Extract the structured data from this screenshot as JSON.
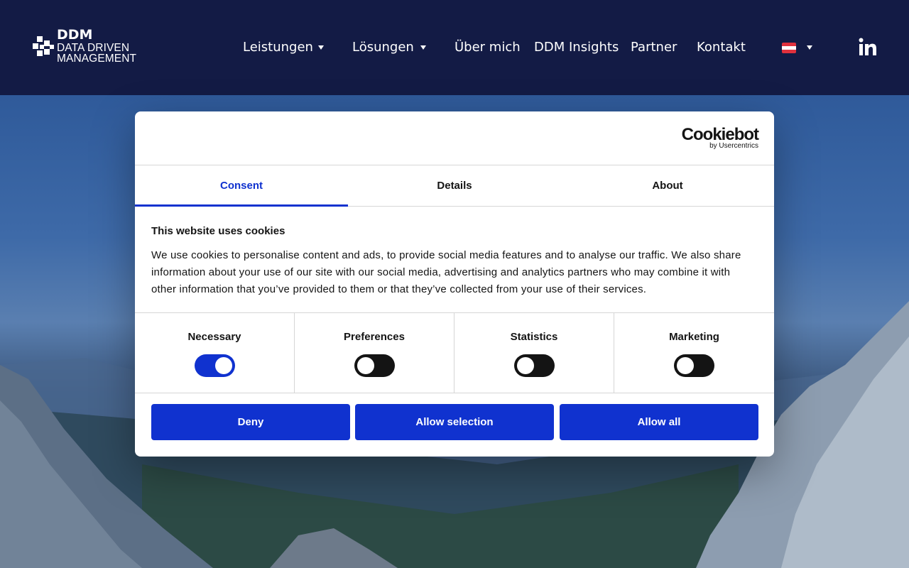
{
  "header": {
    "logo": {
      "mark_text": "DDM",
      "subtitle": "DATA DRIVEN MANAGEMENT"
    },
    "nav": [
      {
        "label": "Leistungen",
        "has_dropdown": true
      },
      {
        "label": "Lösungen",
        "has_dropdown": true
      },
      {
        "label": "Über mich",
        "has_dropdown": false
      },
      {
        "label": "DDM Insights",
        "has_dropdown": false
      },
      {
        "label": "Partner",
        "has_dropdown": false
      },
      {
        "label": "Kontakt",
        "has_dropdown": false
      }
    ],
    "language_flag": "austria-flag-icon",
    "social_icon": "linkedin-icon"
  },
  "cookie_dialog": {
    "brand": {
      "name": "Cookiebot",
      "by": "by Usercentrics"
    },
    "tabs": [
      {
        "label": "Consent",
        "active": true
      },
      {
        "label": "Details",
        "active": false
      },
      {
        "label": "About",
        "active": false
      }
    ],
    "heading": "This website uses cookies",
    "description": "We use cookies to personalise content and ads, to provide social media features and to analyse our traffic. We also share information about your use of our site with our social media, advertising and analytics partners who may combine it with other information that you’ve provided to them or that they’ve collected from your use of their services.",
    "categories": [
      {
        "label": "Necessary",
        "enabled": true
      },
      {
        "label": "Preferences",
        "enabled": false
      },
      {
        "label": "Statistics",
        "enabled": false
      },
      {
        "label": "Marketing",
        "enabled": false
      }
    ],
    "buttons": {
      "deny": "Deny",
      "allow_selection": "Allow selection",
      "allow_all": "Allow all"
    }
  },
  "colors": {
    "header_bg": "#131b45",
    "accent": "#1032cf",
    "text": "#141414"
  }
}
